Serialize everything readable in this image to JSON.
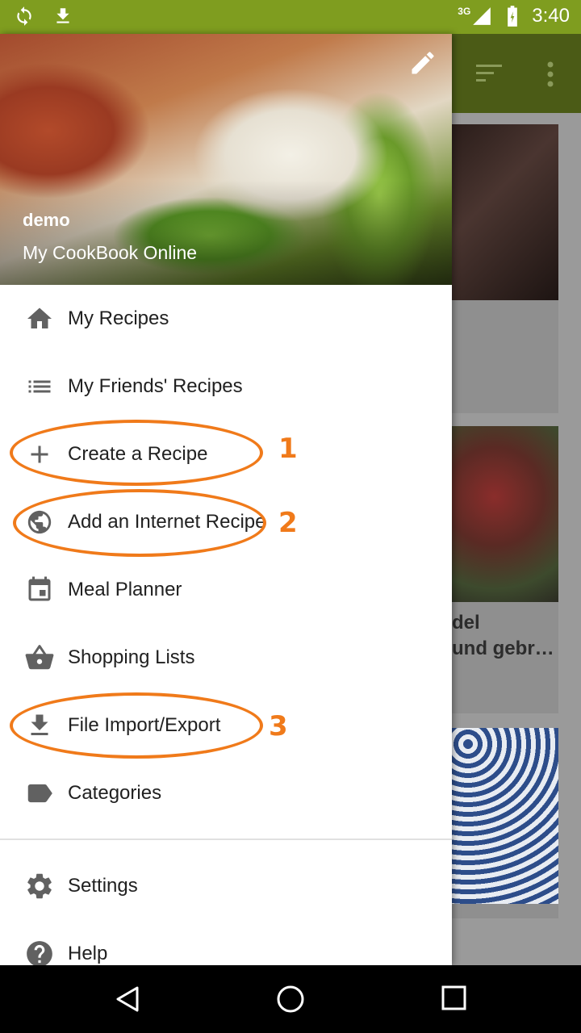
{
  "status_bar": {
    "time": "3:40",
    "network": "3G",
    "icons": [
      "sync-icon",
      "download-icon",
      "signal-icon",
      "battery-icon"
    ]
  },
  "header": {
    "username": "demo",
    "subtitle": "My CookBook Online"
  },
  "menu": {
    "items": [
      {
        "label": "My Recipes",
        "icon": "home-icon"
      },
      {
        "label": "My Friends' Recipes",
        "icon": "list-icon"
      },
      {
        "label": "Create a Recipe",
        "icon": "plus-icon"
      },
      {
        "label": "Add an Internet Recipe",
        "icon": "globe-icon"
      },
      {
        "label": "Meal Planner",
        "icon": "calendar-icon"
      },
      {
        "label": "Shopping Lists",
        "icon": "basket-icon"
      },
      {
        "label": "File Import/Export",
        "icon": "download-icon"
      },
      {
        "label": "Categories",
        "icon": "label-icon"
      }
    ],
    "secondary": [
      {
        "label": "Settings",
        "icon": "gear-icon"
      },
      {
        "label": "Help",
        "icon": "help-icon"
      }
    ]
  },
  "annotations": [
    "1",
    "2",
    "3"
  ],
  "background_card": {
    "title_line1": "del",
    "title_line2": "und gebr…"
  },
  "colors": {
    "status_bar": "#7f9d1f",
    "toolbar_dimmed": "#4b5b16",
    "annotation": "#f07a1a",
    "icon": "#616161"
  }
}
